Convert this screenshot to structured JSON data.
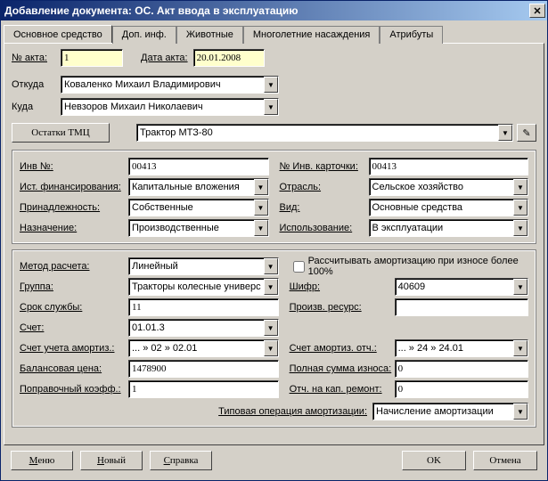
{
  "window": {
    "title": "Добавление документа: ОС. Акт ввода в эксплуатацию"
  },
  "tabs": {
    "t0": "Основное средство",
    "t1": "Доп. инф.",
    "t2": "Животные",
    "t3": "Многолетние насаждения",
    "t4": "Атрибуты"
  },
  "labels": {
    "act_no": "№ акта:",
    "act_date": "Дата акта:",
    "from": "Откуда",
    "to": "Куда",
    "leftovers": "Остатки ТМЦ",
    "inv_no": "Инв №:",
    "card_no": "№ Инв. карточки:",
    "fin_source": "Ист. финансирования:",
    "branch": "Отрасль:",
    "ownership": "Принадлежность:",
    "kind": "Вид:",
    "purpose": "Назначение:",
    "usage": "Использование:",
    "method": "Метод расчета:",
    "recalc": "Рассчитывать амортизацию при износе более 100%",
    "group": "Группа:",
    "cipher": "Шифр:",
    "lifetime": "Срок службы:",
    "prod_res": "Произв. ресурс:",
    "account": "Счет:",
    "amort_acc": "Счет учета амортиз.:",
    "amort_ded_acc": "Счет амортиз. отч.:",
    "balance_price": "Балансовая цена:",
    "wear_full": "Полная сумма износа:",
    "corr_factor": "Поправочный коэфф.:",
    "cap_repair": "Отч. на кап. ремонт:",
    "amort_op": "Типовая операция амортизации:"
  },
  "values": {
    "act_no": "1",
    "act_date": "20.01.2008",
    "from": "Коваленко Михаил Владимирович",
    "to": "Невзоров  Михаил  Николаевич",
    "asset": "Трактор МТЗ-80",
    "inv_no": "00413",
    "card_no": "00413",
    "fin_source": "Капитальные вложения",
    "branch": "Сельское хозяйство",
    "ownership": "Собственные",
    "kind": "Основные средства",
    "purpose": "Производственные",
    "usage": "В эксплуатации",
    "method": "Линейный",
    "group": "Тракторы колесные универс",
    "cipher": "40609",
    "lifetime": "11",
    "prod_res": "",
    "account": "01.01.3",
    "amort_acc": "... » 02 » 02.01",
    "amort_ded_acc": "... » 24 » 24.01",
    "balance_price": "1478900",
    "wear_full": "0",
    "corr_factor": "1",
    "cap_repair": "0",
    "amort_op": "Начисление амортизации"
  },
  "buttons": {
    "menu": "Меню",
    "new": "Новый",
    "help": "Справка",
    "ok": "OK",
    "cancel": "Отмена"
  }
}
